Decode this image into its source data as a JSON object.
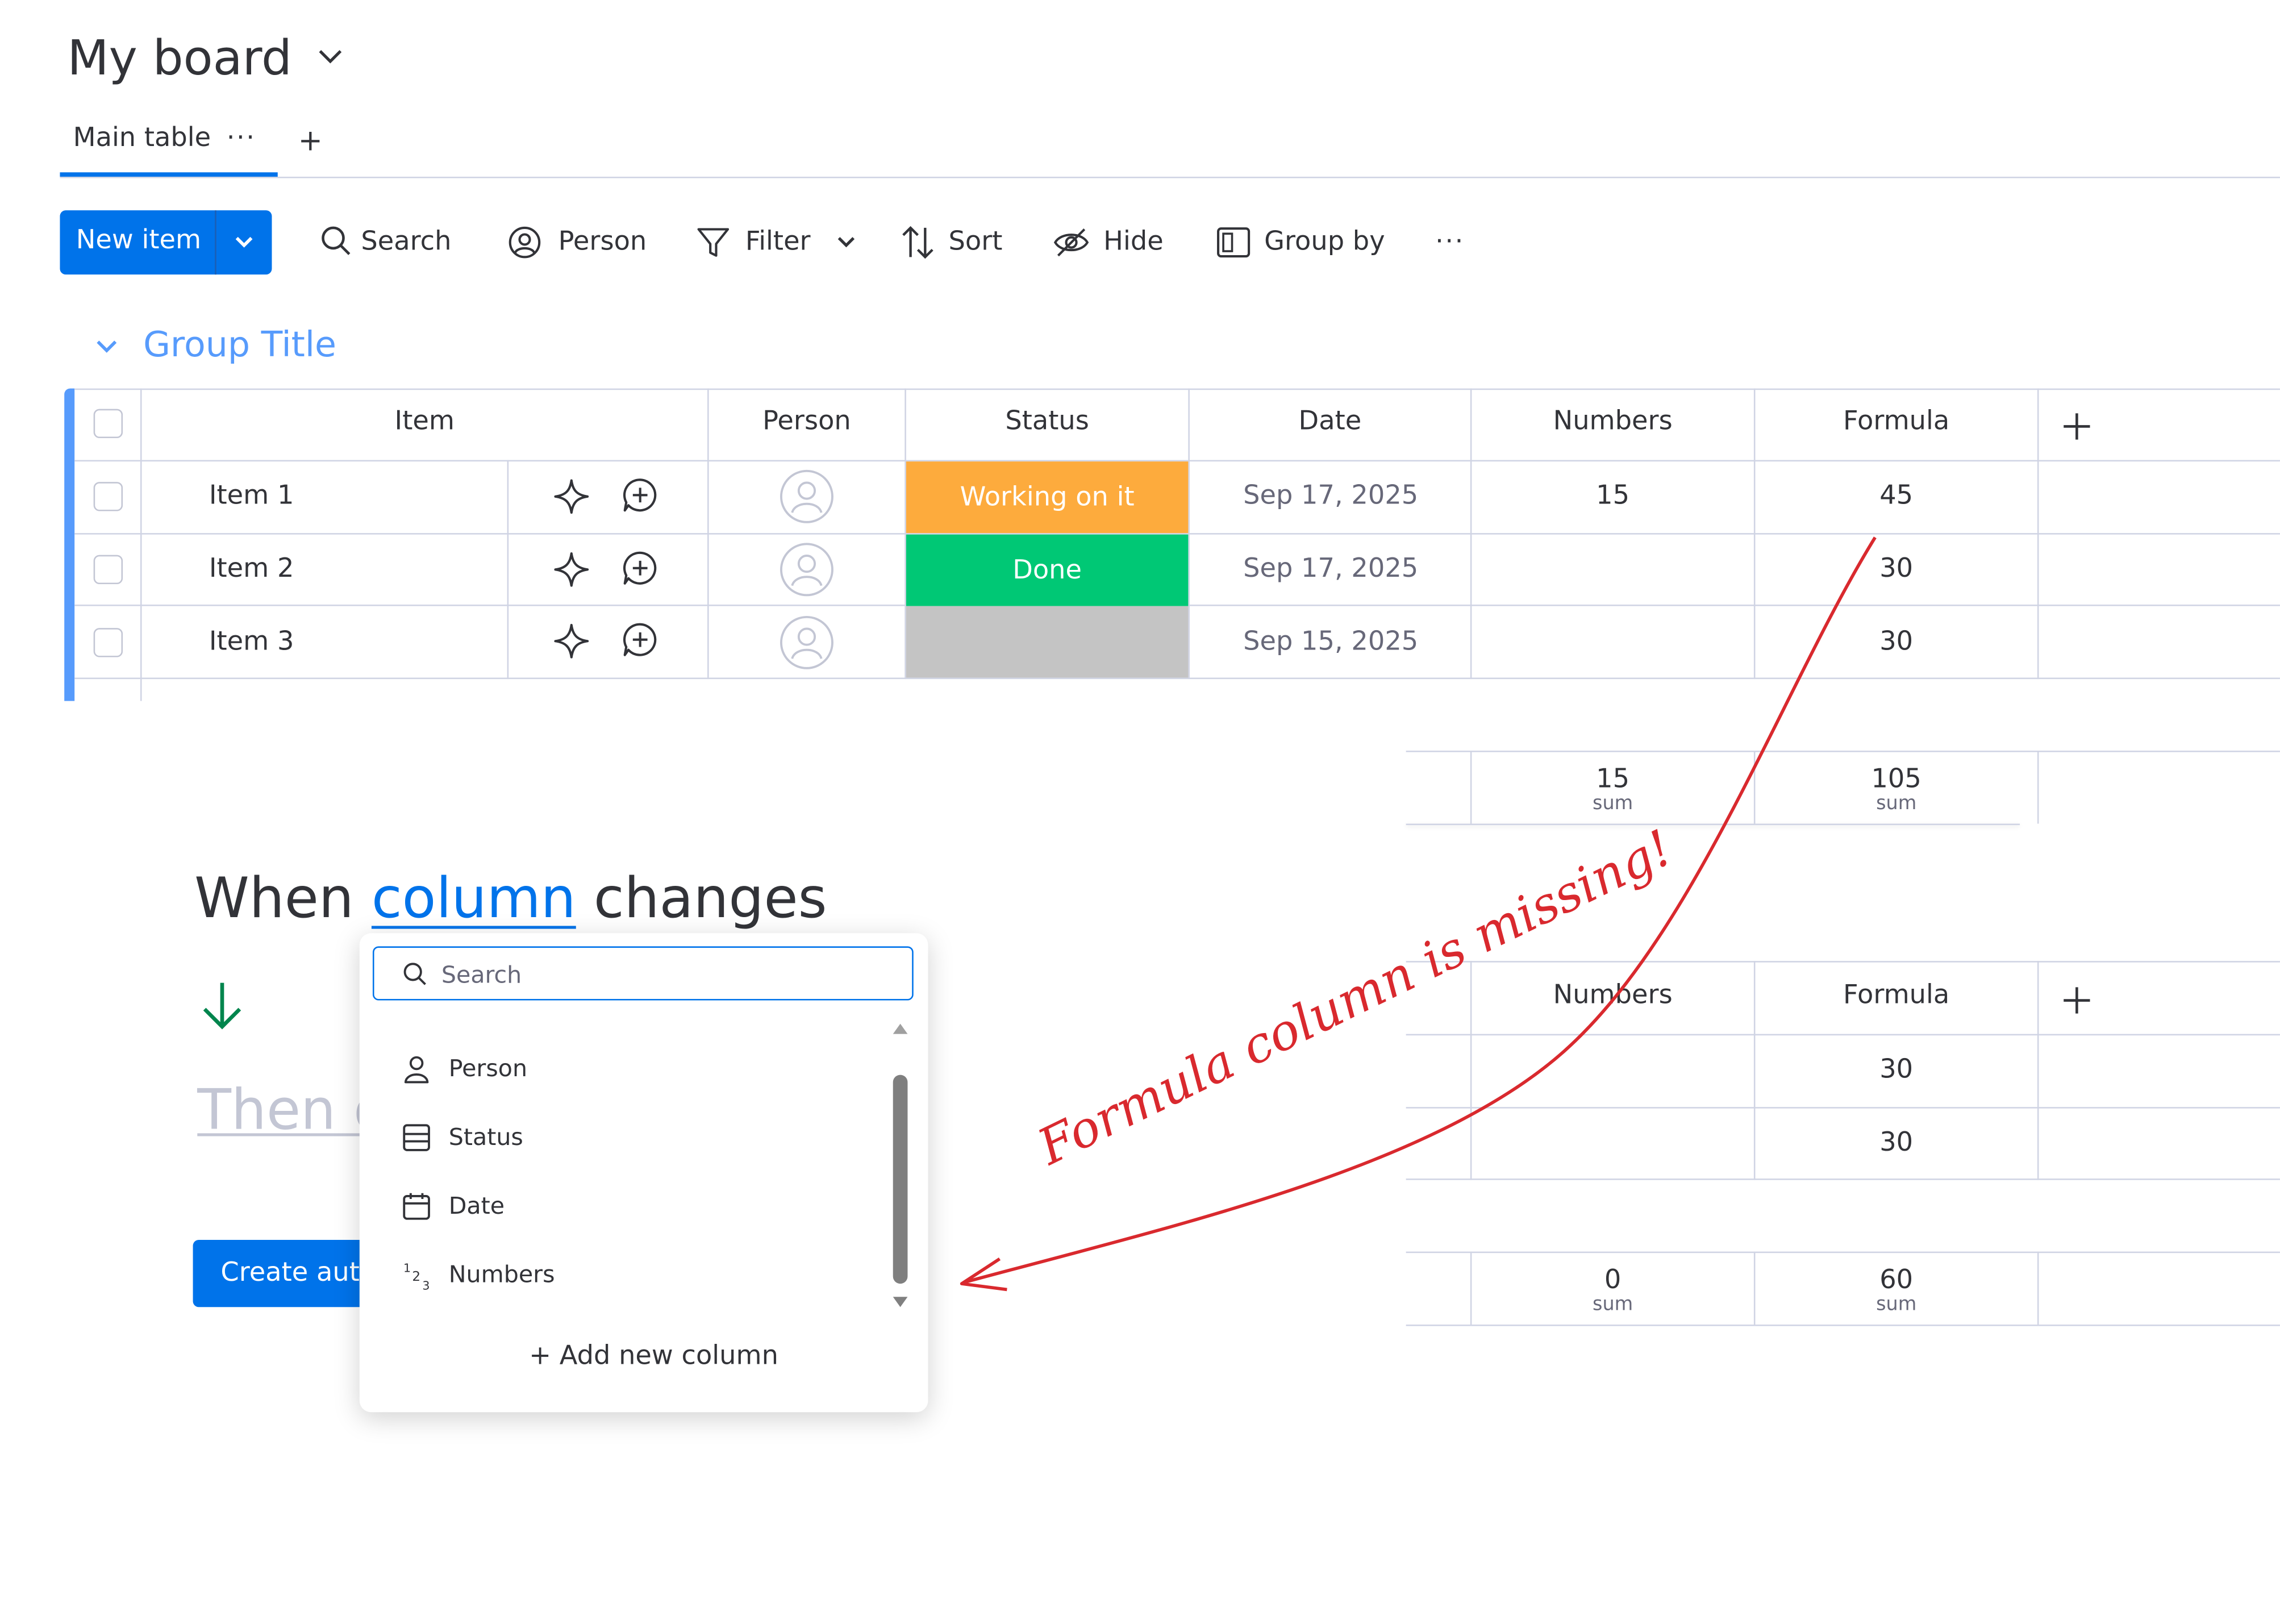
{
  "board": {
    "title": "My board"
  },
  "tabs": {
    "main_table": "Main table",
    "more": "···",
    "add": "+"
  },
  "toolbar": {
    "new_item": "New item",
    "search": "Search",
    "person": "Person",
    "filter": "Filter",
    "sort": "Sort",
    "hide": "Hide",
    "group_by": "Group by",
    "more": "···"
  },
  "group": {
    "title": "Group Title",
    "columns": [
      "Item",
      "Person",
      "Status",
      "Date",
      "Numbers",
      "Formula"
    ],
    "add_column": "+",
    "rows": [
      {
        "item": "Item 1",
        "status": "Working on it",
        "status_color": "#fdab3d",
        "date": "Sep 17, 2025",
        "numbers": "15",
        "formula": "45"
      },
      {
        "item": "Item 2",
        "status": "Done",
        "status_color": "#00c875",
        "date": "Sep 17, 2025",
        "numbers": "",
        "formula": "30"
      },
      {
        "item": "Item 3",
        "status": "",
        "status_color": "#c4c4c4",
        "date": "Sep 15, 2025",
        "numbers": "",
        "formula": "30"
      }
    ],
    "summary": {
      "numbers": "15",
      "numbers_label": "sum",
      "formula": "105",
      "formula_label": "sum"
    }
  },
  "group2": {
    "columns": [
      "Numbers",
      "Formula"
    ],
    "add_column": "+",
    "rows": [
      {
        "formula": "30"
      },
      {
        "formula": "30"
      }
    ],
    "summary": {
      "numbers": "0",
      "numbers_label": "sum",
      "formula": "60",
      "formula_label": "sum"
    }
  },
  "automation": {
    "when_prefix": "When ",
    "when_column": "column",
    "when_suffix": " changes",
    "then_text": "Then d",
    "create_button": "Create auto"
  },
  "dropdown": {
    "search_placeholder": "Search",
    "items": [
      "Person",
      "Status",
      "Date",
      "Numbers"
    ],
    "add_new": "+ Add new column"
  },
  "annotation": {
    "text": "Formula column is missing!",
    "color": "#d9292e"
  },
  "colors": {
    "accent": "#0073ea",
    "group": "#579bfc",
    "working": "#fdab3d",
    "done": "#00c875",
    "empty": "#c4c4c4"
  }
}
